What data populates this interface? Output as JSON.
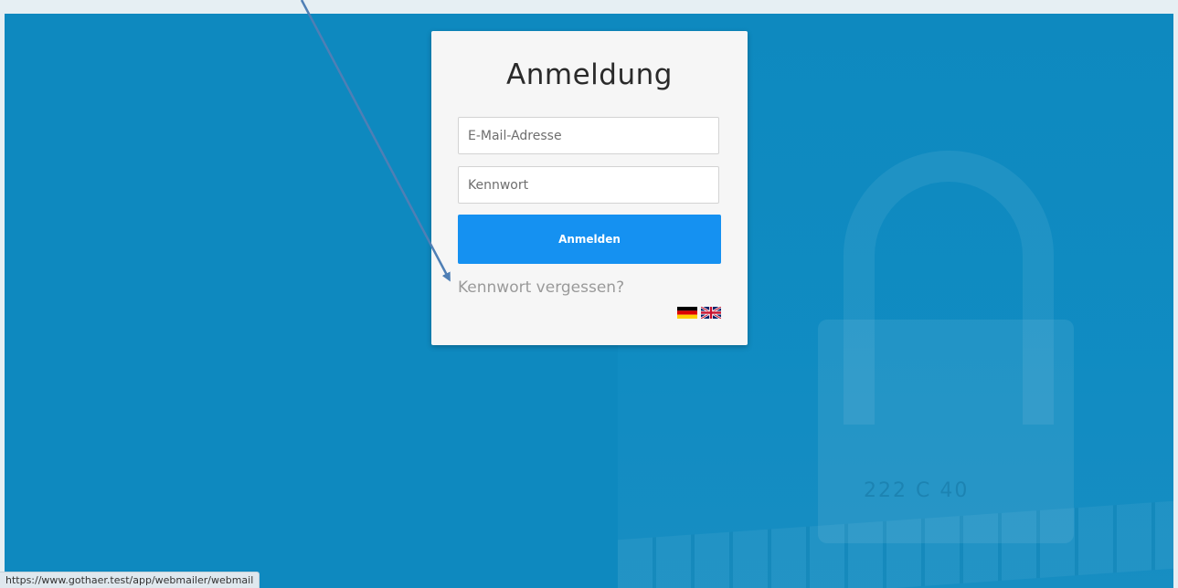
{
  "login": {
    "title": "Anmeldung",
    "email_placeholder": "E-Mail-Adresse",
    "password_placeholder": "Kennwort",
    "submit_label": "Anmelden",
    "forgot_link": "Kennwort vergessen?"
  },
  "languages": [
    {
      "code": "de",
      "icon": "german-flag-icon"
    },
    {
      "code": "en",
      "icon": "uk-flag-icon"
    }
  ],
  "background": {
    "lock_engraving": "222 C 40"
  },
  "status_bar": {
    "url": "https://www.gothaer.test/app/webmailer/webmail"
  },
  "colors": {
    "page_background": "#0e89bf",
    "card_background": "#f6f6f6",
    "primary_button": "#1591f1",
    "annotation_arrow": "#4f7fb5"
  }
}
